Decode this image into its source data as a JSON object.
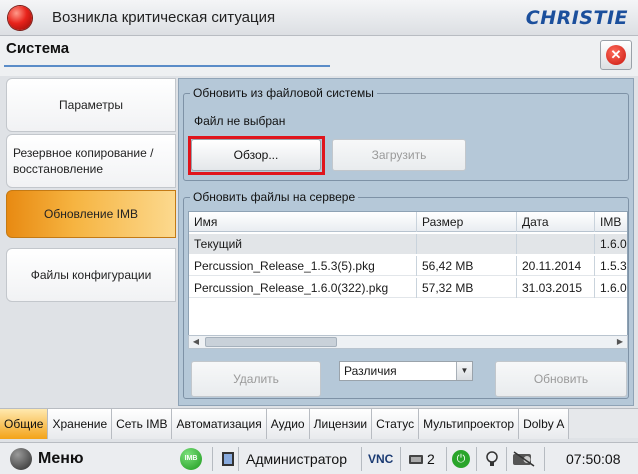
{
  "window": {
    "title": "Возникла критическая ситуация",
    "brand": "CHRISTIE"
  },
  "section": {
    "title": "Система",
    "close_symbol": "✕"
  },
  "leftnav": {
    "items": [
      {
        "label": "Параметры"
      },
      {
        "label": "Резервное копирование / восстановление"
      },
      {
        "label": "Обновление IMB"
      },
      {
        "label": "Файлы конфигурации"
      }
    ],
    "active_index": 2
  },
  "filesystem_group": {
    "title": "Обновить из файловой системы",
    "status": "Файл не выбран",
    "browse_label": "Обзор...",
    "upload_label": "Загрузить"
  },
  "server_group": {
    "title": "Обновить файлы на сервере",
    "columns": [
      "Имя",
      "Размер",
      "Дата",
      "IMB"
    ],
    "current_row": [
      "Текущий",
      "",
      "",
      "1.6.0("
    ],
    "rows": [
      [
        "Percussion_Release_1.5.3(5).pkg",
        "56,42 MB",
        "20.11.2014",
        "1.5.3("
      ],
      [
        "Percussion_Release_1.6.0(322).pkg",
        "57,32 MB",
        "31.03.2015",
        "1.6.0("
      ]
    ],
    "delete_label": "Удалить",
    "filter_value": "Различия",
    "update_label": "Обновить"
  },
  "tabs": [
    {
      "label": "Общие"
    },
    {
      "label": "Хранение"
    },
    {
      "label": "Сеть IMB"
    },
    {
      "label": "Автоматизация"
    },
    {
      "label": "Аудио"
    },
    {
      "label": "Лицензии"
    },
    {
      "label": "Статус"
    },
    {
      "label": "Мультипроектор"
    },
    {
      "label": "Dolby A"
    }
  ],
  "statusbar": {
    "menu_label": "Меню",
    "imb_label": "IMB",
    "user": "Администратор",
    "vnc": "VNC",
    "sessions": "2",
    "time": "07:50:08"
  },
  "colors": {
    "accent_orange": "#f3a319",
    "highlight_red": "#e0141c",
    "panel_blue": "#b5c8d8",
    "brand_blue": "#1b4f9c"
  },
  "icons": [
    "status-red-icon",
    "close-icon",
    "menu-logo-icon",
    "imb-status-icon",
    "monitor-icon",
    "user-icon",
    "vnc-icon",
    "sessions-icon",
    "power-icon",
    "bulb-icon",
    "projector-icon"
  ]
}
